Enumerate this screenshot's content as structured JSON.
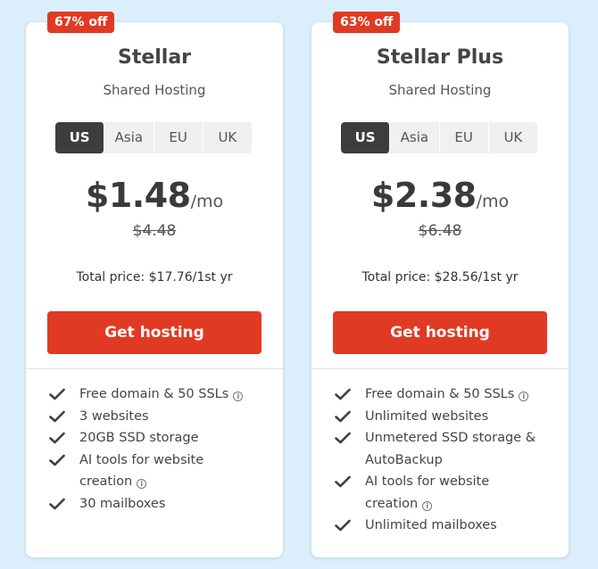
{
  "plans": [
    {
      "badge": "67% off",
      "name": "Stellar",
      "type": "Shared Hosting",
      "regions": [
        "US",
        "Asia",
        "EU",
        "UK"
      ],
      "selected_region": "US",
      "price_amount": "$1.48",
      "price_period": "/mo",
      "old_price": "$4.48",
      "total": "Total price: $17.76/1st yr",
      "cta": "Get hosting",
      "features": [
        {
          "text": "Free domain & 50 SSLs",
          "info": true
        },
        {
          "text": "3 websites",
          "info": false
        },
        {
          "text": "20GB SSD storage",
          "info": false
        },
        {
          "text": "AI tools for website creation",
          "info": true
        },
        {
          "text": "30 mailboxes",
          "info": false
        }
      ]
    },
    {
      "badge": "63% off",
      "name": "Stellar Plus",
      "type": "Shared Hosting",
      "regions": [
        "US",
        "Asia",
        "EU",
        "UK"
      ],
      "selected_region": "US",
      "price_amount": "$2.38",
      "price_period": "/mo",
      "old_price": "$6.48",
      "total": "Total price: $28.56/1st yr",
      "cta": "Get hosting",
      "features": [
        {
          "text": "Free domain & 50 SSLs",
          "info": true
        },
        {
          "text": "Unlimited websites",
          "info": false
        },
        {
          "text": "Unmetered SSD storage & AutoBackup",
          "info": false
        },
        {
          "text": "AI tools for website creation",
          "info": true
        },
        {
          "text": "Unlimited mailboxes",
          "info": false
        }
      ]
    }
  ],
  "icons": {
    "check": "check-icon",
    "info": "info-icon"
  },
  "colors": {
    "background": "#daeefb",
    "accent": "#e03a24",
    "region_active": "#3d3d3d"
  }
}
